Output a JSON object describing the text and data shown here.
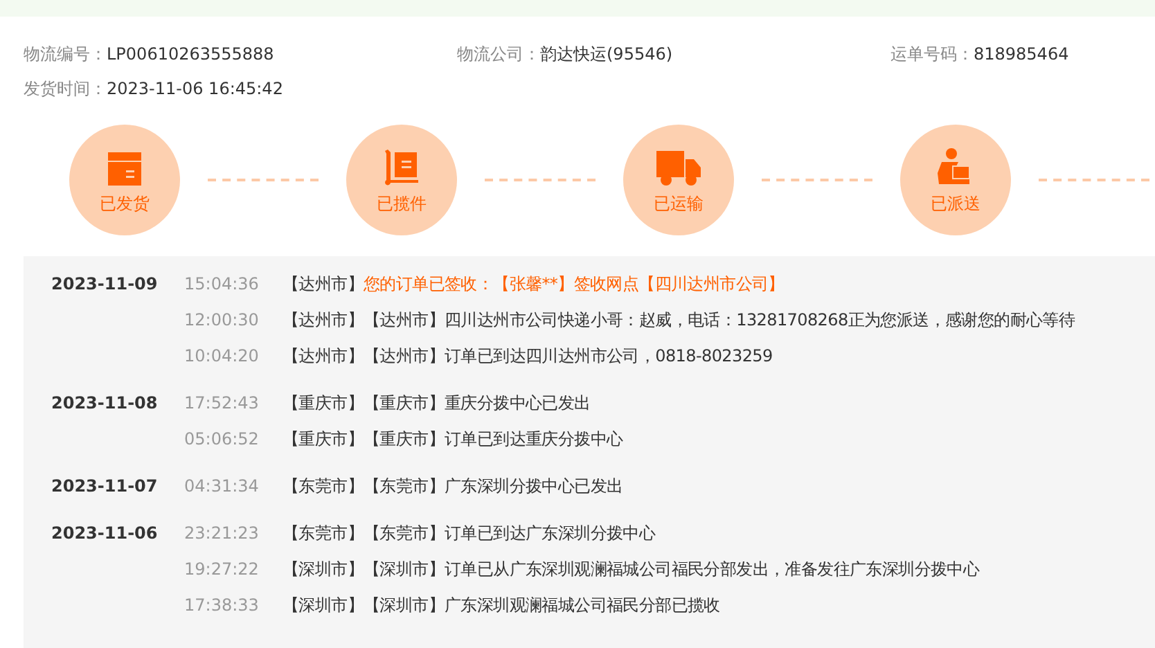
{
  "info": [
    {
      "label": "物流编号：",
      "value": "LP00610263555888"
    },
    {
      "label": "物流公司：",
      "value": "韵达快运(95546)"
    },
    {
      "label": "运单号码：",
      "value": "818985464"
    },
    {
      "label": "发货时间：",
      "value": "2023-11-06 16:45:42"
    }
  ],
  "steps": [
    {
      "kind": "box",
      "label": "已发货"
    },
    {
      "kind": "cart",
      "label": "已揽件"
    },
    {
      "kind": "truck",
      "label": "已运输"
    },
    {
      "kind": "courier",
      "label": "已派送"
    }
  ],
  "timeline": [
    {
      "date": "2023-11-09",
      "entries": [
        {
          "time": "15:04:36",
          "place": "【达州市】",
          "message": "您的订单已签收：【张馨**】签收网点【四川达州市公司】",
          "highlight": true
        },
        {
          "time": "12:00:30",
          "place": "【达州市】【达州市】",
          "message": "四川达州市公司快递小哥：赵威，电话：13281708268正为您派送，感谢您的耐心等待",
          "highlight": false
        },
        {
          "time": "10:04:20",
          "place": "【达州市】【达州市】",
          "message": "订单已到达四川达州市公司，0818-8023259",
          "highlight": false
        }
      ]
    },
    {
      "date": "2023-11-08",
      "entries": [
        {
          "time": "17:52:43",
          "place": "【重庆市】【重庆市】",
          "message": "重庆分拨中心已发出",
          "highlight": false
        },
        {
          "time": "05:06:52",
          "place": "【重庆市】【重庆市】",
          "message": "订单已到达重庆分拨中心",
          "highlight": false
        }
      ]
    },
    {
      "date": "2023-11-07",
      "entries": [
        {
          "time": "04:31:34",
          "place": "【东莞市】【东莞市】",
          "message": "广东深圳分拨中心已发出",
          "highlight": false
        }
      ]
    },
    {
      "date": "2023-11-06",
      "entries": [
        {
          "time": "23:21:23",
          "place": "【东莞市】【东莞市】",
          "message": "订单已到达广东深圳分拨中心",
          "highlight": false
        },
        {
          "time": "19:27:22",
          "place": "【深圳市】【深圳市】",
          "message": "订单已从广东深圳观澜福城公司福民分部发出，准备发往广东深圳分拨中心",
          "highlight": false
        },
        {
          "time": "17:38:33",
          "place": "【深圳市】【深圳市】",
          "message": "广东深圳观澜福城公司福民分部已揽收",
          "highlight": false
        }
      ]
    }
  ]
}
